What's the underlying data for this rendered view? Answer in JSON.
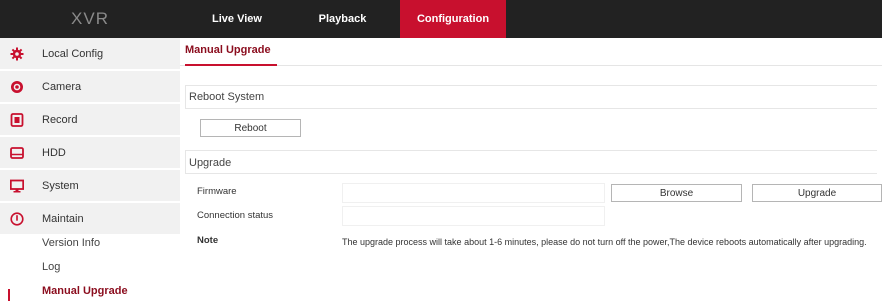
{
  "header": {
    "logo": "XVR",
    "tabs": [
      {
        "label": "Live View"
      },
      {
        "label": "Playback"
      },
      {
        "label": "Configuration",
        "active": true
      }
    ]
  },
  "sidebar": {
    "items": [
      {
        "label": "Local Config",
        "icon": "gear-icon"
      },
      {
        "label": "Camera",
        "icon": "camera-icon"
      },
      {
        "label": "Record",
        "icon": "record-icon"
      },
      {
        "label": "HDD",
        "icon": "hdd-icon"
      },
      {
        "label": "System",
        "icon": "monitor-icon"
      },
      {
        "label": "Maintain",
        "icon": "power-icon"
      }
    ],
    "sub_items": [
      {
        "label": "Version Info"
      },
      {
        "label": "Log"
      },
      {
        "label": "Manual Upgrade",
        "active": true
      }
    ]
  },
  "main": {
    "page_tab": "Manual Upgrade",
    "reboot": {
      "section_title": "Reboot System",
      "button_label": "Reboot"
    },
    "upgrade": {
      "section_title": "Upgrade",
      "firmware_label": "Firmware",
      "firmware_value": "",
      "browse_label": "Browse",
      "upgrade_label": "Upgrade",
      "connection_label": "Connection status",
      "connection_value": "",
      "note_label": "Note",
      "note_text": "The upgrade process will take about 1-6 minutes, please do not turn off the power,The device reboots automatically after upgrading."
    }
  },
  "colors": {
    "accent": "#c8102e",
    "accent_text": "#8b0d1e",
    "topbar": "#222222",
    "sidebar_bg": "#f1f1f1"
  }
}
